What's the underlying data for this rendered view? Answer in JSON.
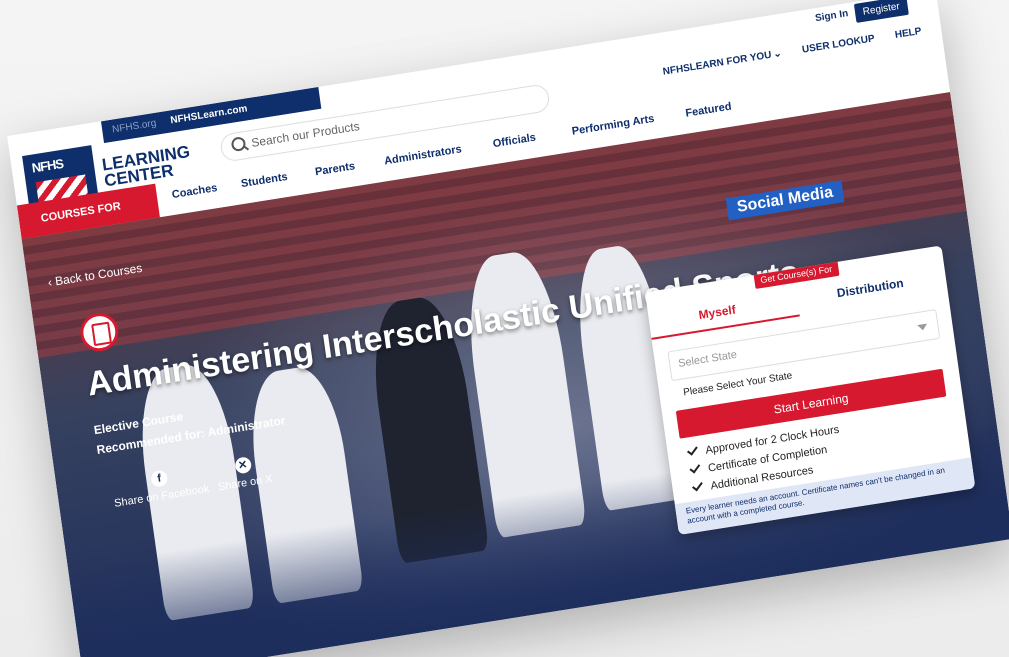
{
  "topbar": {
    "site1": "NFHS.org",
    "site2": "NFHSLearn.com",
    "sign_in": "Sign In",
    "register": "Register"
  },
  "header": {
    "logo_text": "NFHS",
    "brand_line1": "LEARNING",
    "brand_line2": "CENTER",
    "search_placeholder": "Search our Products",
    "right_nav": [
      "NFHSLEARN FOR YOU",
      "USER LOOKUP",
      "HELP"
    ],
    "courses_for": "COURSES FOR",
    "categories": [
      "Coaches",
      "Students",
      "Parents",
      "Administrators",
      "Officials",
      "Performing Arts",
      "Featured"
    ]
  },
  "hero": {
    "back": "Back to Courses",
    "title": "Administering Interscholastic Unified Sports",
    "course_type": "Elective Course",
    "recommended": "Recommended for: Administrator",
    "share_facebook": "Share on Facebook",
    "share_x": "Share on X",
    "sign_text": "Social Media"
  },
  "card": {
    "badge": "Get Course(s) For",
    "tab_myself": "Myself",
    "tab_distribution": "Distribution",
    "select_state": "Select State",
    "hint": "Please Select Your State",
    "start": "Start Learning",
    "features": [
      "Approved for 2 Clock Hours",
      "Certificate of Completion",
      "Additional Resources"
    ],
    "note": "Every learner needs an account. Certificate names can't be changed in an account with a completed course."
  },
  "colors": {
    "navy": "#0e2f6b",
    "red": "#d7192f"
  },
  "icons": [
    "search-icon",
    "chevron-down-icon",
    "facebook-icon",
    "x-icon",
    "clipboard-icon",
    "checkmark-icon"
  ]
}
